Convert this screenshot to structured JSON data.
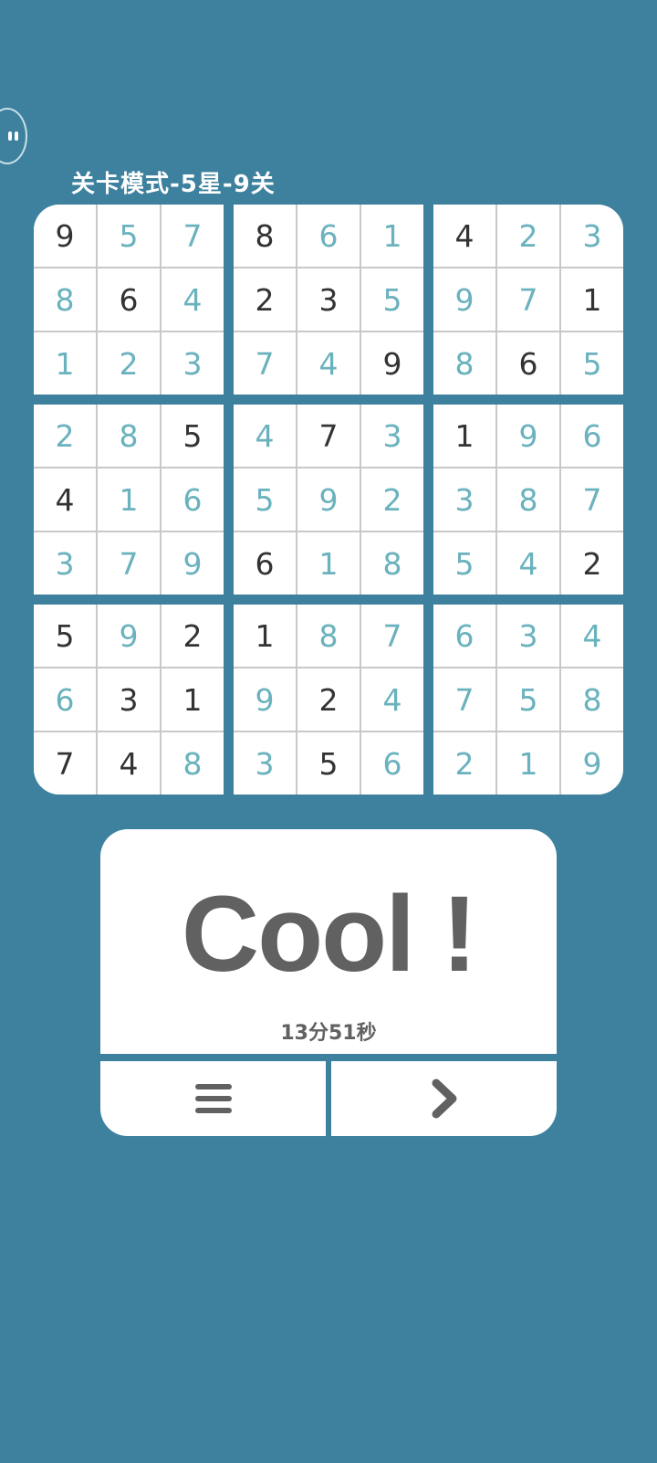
{
  "header": {
    "level_title": "关卡模式-5星-9关"
  },
  "board": {
    "rows": [
      [
        9,
        5,
        7,
        8,
        6,
        1,
        4,
        2,
        3
      ],
      [
        8,
        6,
        4,
        2,
        3,
        5,
        9,
        7,
        1
      ],
      [
        1,
        2,
        3,
        7,
        4,
        9,
        8,
        6,
        5
      ],
      [
        2,
        8,
        5,
        4,
        7,
        3,
        1,
        9,
        6
      ],
      [
        4,
        1,
        6,
        5,
        9,
        2,
        3,
        8,
        7
      ],
      [
        3,
        7,
        9,
        6,
        1,
        8,
        5,
        4,
        2
      ],
      [
        5,
        9,
        2,
        1,
        8,
        7,
        6,
        3,
        4
      ],
      [
        6,
        3,
        1,
        9,
        2,
        4,
        7,
        5,
        8
      ],
      [
        7,
        4,
        8,
        3,
        5,
        6,
        2,
        1,
        9
      ]
    ],
    "given": [
      [
        1,
        0,
        0,
        1,
        0,
        0,
        1,
        0,
        0
      ],
      [
        0,
        1,
        0,
        1,
        1,
        0,
        0,
        0,
        1
      ],
      [
        0,
        0,
        0,
        0,
        0,
        1,
        0,
        1,
        0
      ],
      [
        0,
        0,
        1,
        0,
        1,
        0,
        1,
        0,
        0
      ],
      [
        1,
        0,
        0,
        0,
        0,
        0,
        0,
        0,
        0
      ],
      [
        0,
        0,
        0,
        1,
        0,
        0,
        0,
        0,
        1
      ],
      [
        1,
        0,
        1,
        1,
        0,
        0,
        0,
        0,
        0
      ],
      [
        0,
        1,
        1,
        0,
        1,
        0,
        0,
        0,
        0
      ],
      [
        1,
        1,
        0,
        0,
        1,
        0,
        0,
        0,
        0
      ]
    ],
    "colors": {
      "given": "#333333",
      "filled": "#6ab2bd",
      "background": "#3d819f"
    }
  },
  "result": {
    "message": "Cool !",
    "time": "13分51秒"
  },
  "buttons": {
    "menu_icon": "menu-icon",
    "next_icon": "chevron-right-icon"
  }
}
